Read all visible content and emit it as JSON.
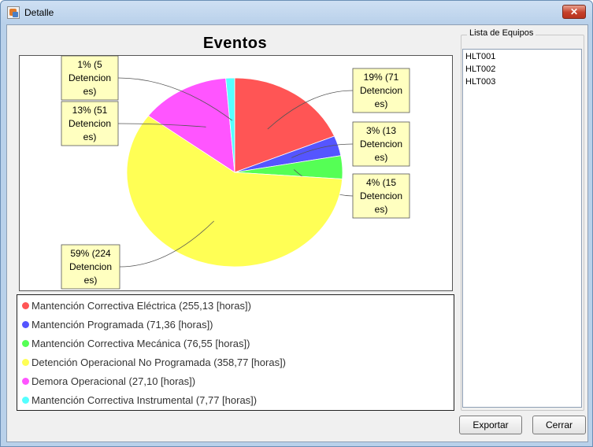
{
  "window": {
    "title": "Detalle",
    "close_symbol": "✕",
    "colors": {
      "frame": "#b9d1ea",
      "client": "#f0f0f0",
      "close": "#c5402a"
    }
  },
  "chart_data": {
    "type": "pie",
    "title": "Eventos",
    "slices": [
      {
        "name": "Mantención Correctiva Eléctrica (255,13 [horas])",
        "percent": 19,
        "count": 71,
        "label": "19% (71 Detenciones)",
        "color": "#ff5555"
      },
      {
        "name": "Mantención Programada (71,36 [horas])",
        "percent": 3,
        "count": 13,
        "label": "3% (13 Detenciones)",
        "color": "#5555ff"
      },
      {
        "name": "Mantención Correctiva Mecánica (76,55 [horas])",
        "percent": 4,
        "count": 15,
        "label": "4% (15 Detenciones)",
        "color": "#55ff55"
      },
      {
        "name": "Detención Operacional No Programada (358,77 [horas])",
        "percent": 59,
        "count": 224,
        "label": "59% (224 Detenciones)",
        "color": "#ffff55"
      },
      {
        "name": "Demora Operacional (27,10 [horas])",
        "percent": 13,
        "count": 51,
        "label": "13% (51 Detenciones)",
        "color": "#ff55ff"
      },
      {
        "name": "Mantención Correctiva Instrumental (7,77 [horas])",
        "percent": 1,
        "count": 5,
        "label": "1% (5 Detenciones)",
        "color": "#55ffff"
      }
    ],
    "label_lines": [
      [
        "19% (71",
        "Detencion",
        "es)"
      ],
      [
        "3% (13",
        "Detencion",
        "es)"
      ],
      [
        "4% (15",
        "Detencion",
        "es)"
      ],
      [
        "59% (224",
        "Detencion",
        "es)"
      ],
      [
        "13% (51",
        "Detencion",
        "es)"
      ],
      [
        "1% (5",
        "Detencion",
        "es)"
      ]
    ],
    "legend_placement": "bottom"
  },
  "equipos": {
    "title": "Lista de Equipos",
    "items": [
      "HLT001",
      "HLT002",
      "HLT003"
    ]
  },
  "buttons": {
    "export_label": "Exportar",
    "close_label": "Cerrar"
  }
}
